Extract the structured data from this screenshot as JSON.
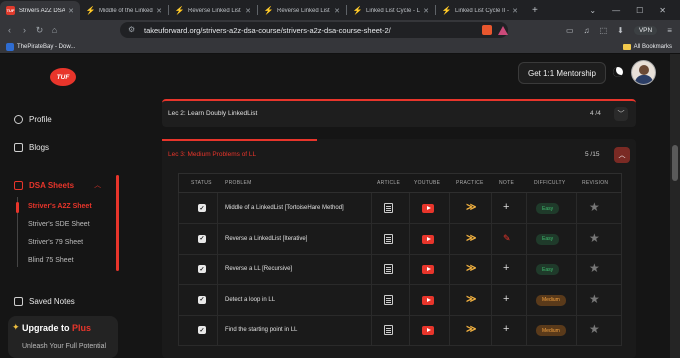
{
  "browser": {
    "tabs": [
      {
        "label": "Strivers A2Z DSA Cou",
        "favicon": "TUF",
        "active": true
      },
      {
        "label": "Middle of the Linked List",
        "favicon": "leetcode-icon"
      },
      {
        "label": "Reverse Linked List - Leet",
        "favicon": "leetcode-icon"
      },
      {
        "label": "Reverse Linked List - Leet",
        "favicon": "leetcode-icon"
      },
      {
        "label": "Linked List Cycle - LeetCo",
        "favicon": "leetcode-icon"
      },
      {
        "label": "Linked List Cycle II - Leet",
        "favicon": "leetcode-icon"
      }
    ],
    "new_tab": "+",
    "window_controls": [
      "⌄",
      "—",
      "☐",
      "✕"
    ],
    "url": "takeuforward.org/strivers-a2z-dsa-course/strivers-a2z-dsa-course-sheet-2/",
    "vpn_label": "VPN",
    "bookmark": "ThePirateBay - Dow...",
    "all_bookmarks": "All Bookmarks"
  },
  "header": {
    "logo_text": "TUF",
    "mentorship_button": "Get 1:1 Mentorship"
  },
  "sidebar": {
    "profile": "Profile",
    "blogs": "Blogs",
    "dsa_sheets": "DSA Sheets",
    "sheets": [
      {
        "label": "Striver's A2Z Sheet",
        "active": true
      },
      {
        "label": "Striver's SDE Sheet",
        "active": false
      },
      {
        "label": "Striver's 79 Sheet",
        "active": false
      },
      {
        "label": "Blind 75 Sheet",
        "active": false
      }
    ],
    "saved_notes": "Saved Notes",
    "upgrade": {
      "title": "Upgrade to ",
      "plus": "Plus",
      "subtitle": "Unleash Your Full Potential"
    }
  },
  "lectures": {
    "lec2": {
      "title": "Lec 2: Learn Doubly LinkedList",
      "count": "4 /4"
    },
    "lec3": {
      "title": "Lec 3: Medium Problems of LL",
      "count": "5 /15",
      "progress": 0.33
    }
  },
  "table": {
    "headers": [
      "STATUS",
      "PROBLEM",
      "ARTICLE",
      "YOUTUBE",
      "PRACTICE",
      "NOTE",
      "DIFFICULTY",
      "REVISION"
    ],
    "rows": [
      {
        "problem": "Middle of a LinkedList [TortoiseHare Method]",
        "checked": true,
        "note": "add",
        "difficulty": "Easy"
      },
      {
        "problem": "Reverse a LinkedList [Iterative]",
        "checked": true,
        "note": "edit",
        "difficulty": "Easy"
      },
      {
        "problem": "Reverse a LL [Recursive]",
        "checked": true,
        "note": "add",
        "difficulty": "Easy"
      },
      {
        "problem": "Detect a loop in LL",
        "checked": true,
        "note": "add",
        "difficulty": "Medium"
      },
      {
        "problem": "Find the starting point in LL",
        "checked": true,
        "note": "add",
        "difficulty": "Medium"
      }
    ]
  }
}
